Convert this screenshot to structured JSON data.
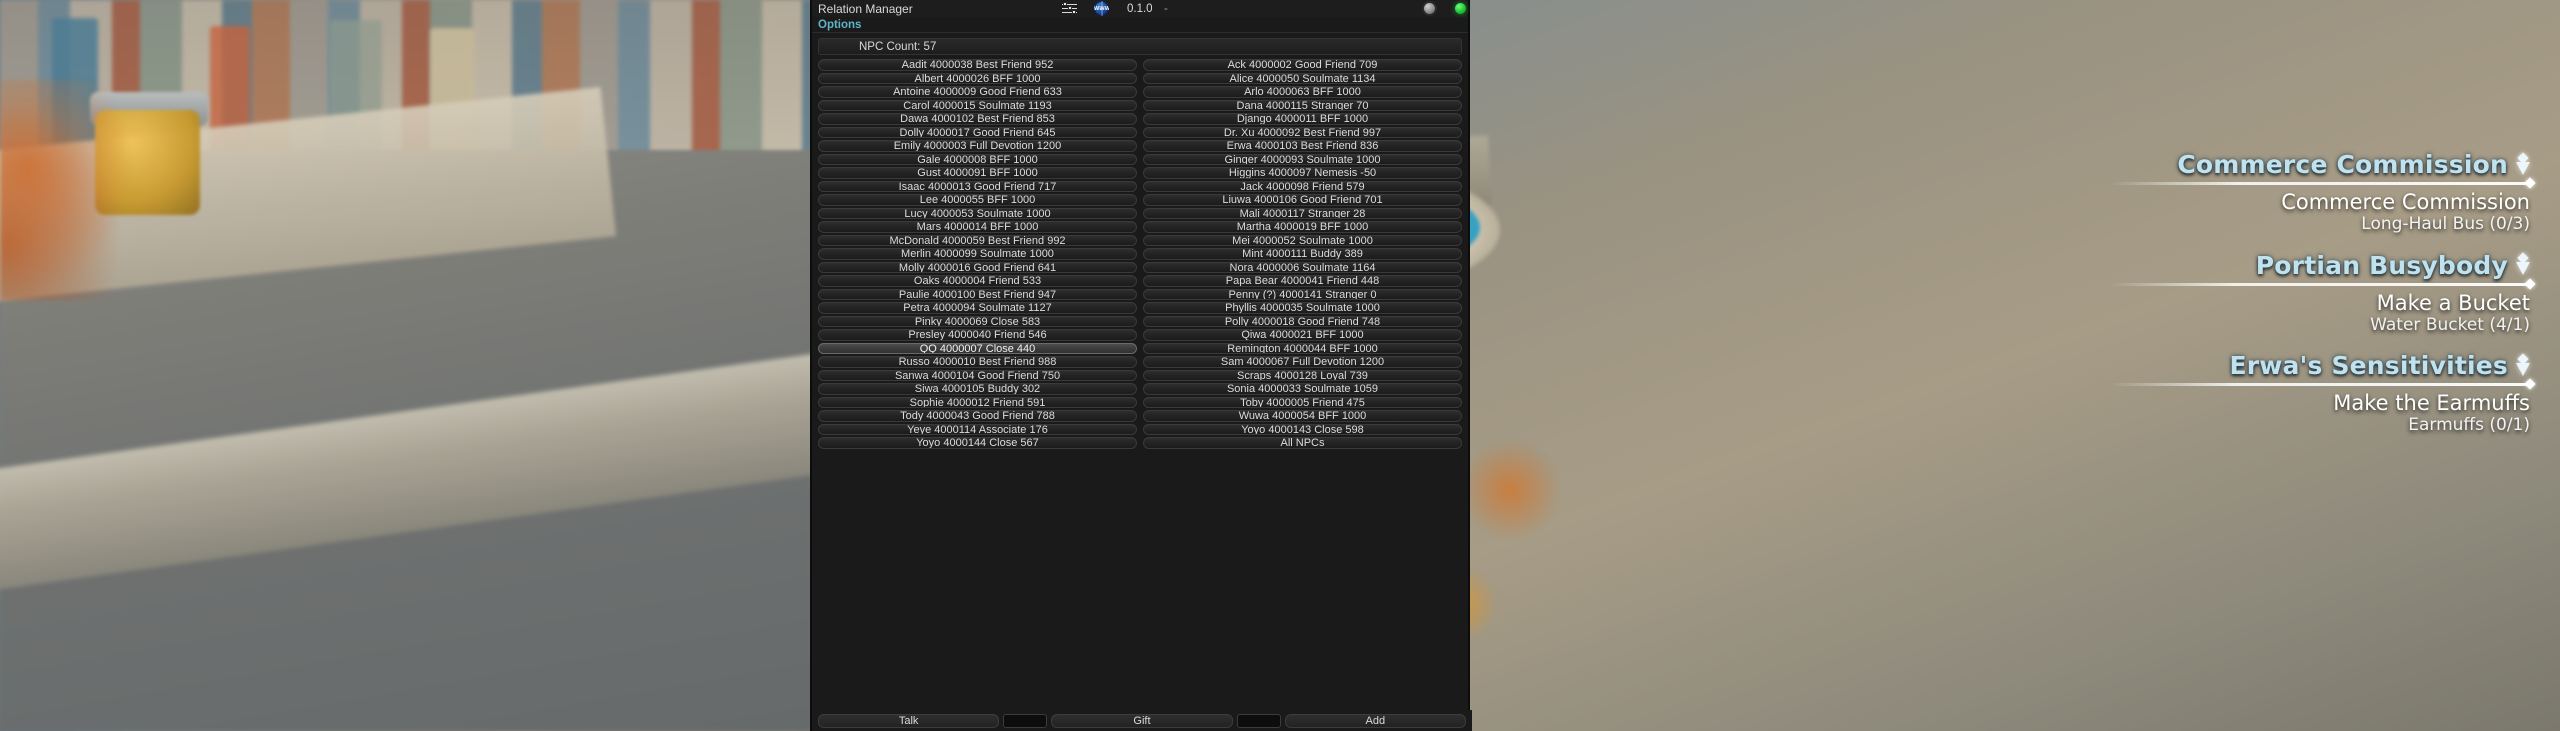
{
  "window": {
    "title": "Relation Manager",
    "options_label": "Options",
    "npc_count_label": "NPC Count:  57"
  },
  "toolbar": {
    "sliders_icon": "sliders-icon",
    "globe_icon": "www-globe-icon",
    "globe_text": "WWW",
    "version": "0.1.0",
    "separator": "-",
    "status_gray_icon": "status-dot-gray",
    "status_green_icon": "status-dot-green"
  },
  "npc_list": {
    "left_column": [
      "Aadit 4000038 Best Friend 952",
      "Albert 4000026 BFF 1000",
      "Antoine 4000009 Good Friend 633",
      "Carol 4000015 Soulmate 1193",
      "Dawa 4000102 Best Friend 853",
      "Dolly 4000017 Good Friend 645",
      "Emily 4000003 Full Devotion 1200",
      "Gale 4000008 BFF 1000",
      "Gust 4000091 BFF 1000",
      "Isaac 4000013 Good Friend 717",
      "Lee 4000055 BFF 1000",
      "Lucy 4000053 Soulmate 1000",
      "Mars 4000014 BFF 1000",
      "McDonald 4000059 Best Friend 992",
      "Merlin 4000099 Soulmate 1000",
      "Molly 4000016 Good Friend 641",
      "Oaks 4000004 Friend 533",
      "Paulie 4000100 Best Friend 947",
      "Petra 4000094 Soulmate 1127",
      "Pinky 4000069 Close 583",
      "Presley 4000040 Friend 546",
      "QQ 4000007 Close 440",
      "Russo 4000010 Best Friend 988",
      "Sanwa 4000104 Good Friend 750",
      "Siwa 4000105 Buddy 302",
      "Sophie 4000012 Friend 591",
      "Tody 4000043 Good Friend 788",
      "Yeye 4000114 Associate 176",
      "Yoyo 4000144 Close 567"
    ],
    "right_column": [
      "Ack 4000002 Good Friend 709",
      "Alice 4000050 Soulmate 1134",
      "Arlo 4000063 BFF 1000",
      "Dana 4000115 Stranger 70",
      "Django 4000011 BFF 1000",
      "Dr. Xu 4000092 Best Friend 997",
      "Erwa 4000103 Best Friend 836",
      "Ginger 4000093 Soulmate 1000",
      "Higgins 4000097 Nemesis -50",
      "Jack 4000098 Friend 579",
      "Liuwa 4000106 Good Friend 701",
      "Mali 4000117 Stranger 28",
      "Martha 4000019 BFF 1000",
      "Mei 4000052 Soulmate 1000",
      "Mint 4000111 Buddy 389",
      "Nora 4000006 Soulmate 1164",
      "Papa Bear 4000041 Friend 448",
      "Penny (?) 4000141 Stranger 0",
      "Phyllis 4000035 Soulmate 1000",
      "Polly 4000018 Good Friend 748",
      "Qiwa 4000021 BFF 1000",
      "Remington 4000044 BFF 1000",
      "Sam 4000067 Full Devotion 1200",
      "Scraps 4000128 Loyal 739",
      "Sonia 4000033 Soulmate 1059",
      "Toby 4000005 Friend 475",
      "Wuwa 4000054 BFF 1000",
      "Yoyo 4000143 Close 598",
      "All NPCs"
    ],
    "selected_index": 21,
    "selected_column": "left"
  },
  "action_bar": {
    "talk_label": "Talk",
    "talk_value": "",
    "gift_label": "Gift",
    "gift_value": "",
    "add_label": "Add"
  },
  "quest_hud": {
    "quests": [
      {
        "title": "Commerce Commission",
        "step": "Commerce Commission",
        "objective": "Long-Haul Bus (0/3)"
      },
      {
        "title": "Portian Busybody",
        "step": "Make a Bucket",
        "objective": "Water Bucket (4/1)"
      },
      {
        "title": "Erwa's Sensitivities",
        "step": "Make the Earmuffs",
        "objective": "Earmuffs (0/1)"
      }
    ]
  },
  "colors": {
    "quest_title": "#bfe2ee",
    "options_accent": "#5fb4c9",
    "panel_bg": "#1a1a1a",
    "status_green": "#17b92c"
  }
}
